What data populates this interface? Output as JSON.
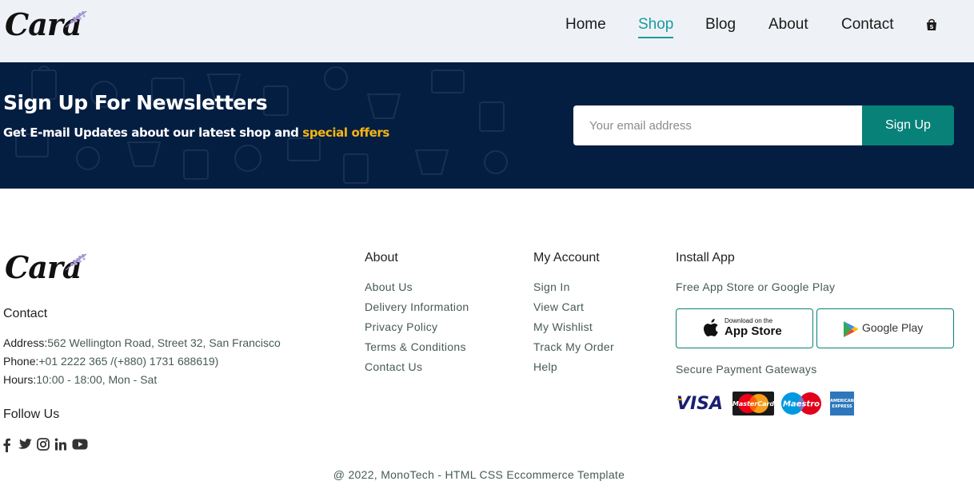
{
  "header": {
    "logo": "Cara",
    "nav": [
      {
        "label": "Home",
        "active": false
      },
      {
        "label": "Shop",
        "active": true
      },
      {
        "label": "Blog",
        "active": false
      },
      {
        "label": "About",
        "active": false
      },
      {
        "label": "Contact",
        "active": false
      }
    ],
    "cart_icon": "shopping-bag-icon"
  },
  "newsletter": {
    "title": "Sign Up For Newsletters",
    "subtitle_prefix": "Get E-mail Updates about our latest shop and",
    "subtitle_highlight": "special offers",
    "email_placeholder": "Your email address",
    "button_label": "Sign Up"
  },
  "footer": {
    "logo": "Cara",
    "contact": {
      "heading": "Contact",
      "address_label": "Address:",
      "address_value": "562 Wellington Road, Street 32, San Francisco",
      "phone_label": "Phone:",
      "phone_value": "+01 2222 365 /(+880) 1731 688619)",
      "hours_label": "Hours:",
      "hours_value": "10:00 - 18:00, Mon - Sat"
    },
    "follow": {
      "heading": "Follow Us",
      "icons": [
        "facebook-icon",
        "twitter-icon",
        "instagram-icon",
        "linkedin-icon",
        "youtube-icon"
      ]
    },
    "about": {
      "heading": "About",
      "links": [
        "About Us",
        "Delivery Information",
        "Privacy Policy",
        "Terms & Conditions",
        "Contact Us"
      ]
    },
    "account": {
      "heading": "My Account",
      "links": [
        "Sign In",
        "View Cart",
        "My Wishlist",
        "Track My Order",
        "Help"
      ]
    },
    "install": {
      "heading": "Install App",
      "subtitle": "Free App Store or Google Play",
      "appstore_small": "Download on the",
      "appstore_big": "App Store",
      "googleplay": "Google Play",
      "payment_heading": "Secure Payment Gateways",
      "payments": [
        "VISA",
        "MasterCard",
        "Maestro",
        "AMERICAN EXPRESS"
      ]
    },
    "copyright": "@ 2022, MonoTech - HTML CSS Eccommerce Template"
  },
  "colors": {
    "accent": "#088178",
    "nav_active": "#1a9ba1",
    "newsletter_bg": "#041e42",
    "highlight": "#f5b512"
  }
}
